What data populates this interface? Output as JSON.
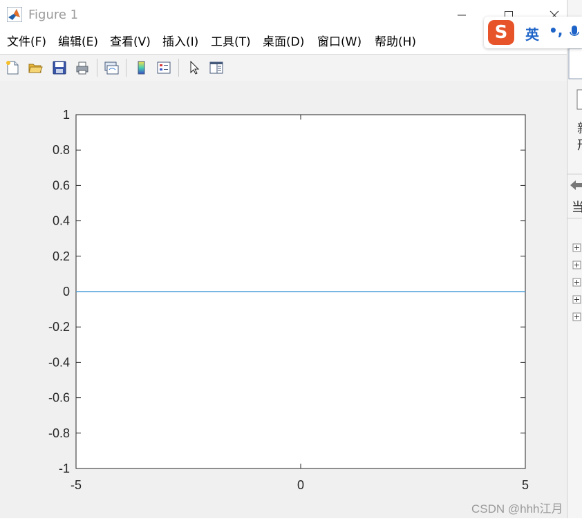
{
  "window": {
    "title": "Figure 1"
  },
  "menu": [
    {
      "label": "文件(F)"
    },
    {
      "label": "编辑(E)"
    },
    {
      "label": "查看(V)"
    },
    {
      "label": "插入(I)"
    },
    {
      "label": "工具(T)"
    },
    {
      "label": "桌面(D)"
    },
    {
      "label": "窗口(W)"
    },
    {
      "label": "帮助(H)"
    }
  ],
  "toolbar": {
    "icons": [
      "new-figure-icon",
      "open-file-icon",
      "save-icon",
      "print-icon",
      "link-plot-icon",
      "colorbar-icon",
      "legend-icon",
      "edit-plot-icon",
      "property-inspector-icon"
    ]
  },
  "chart_data": {
    "type": "line",
    "title": "",
    "xlabel": "",
    "ylabel": "",
    "xlim": [
      -5,
      5
    ],
    "ylim": [
      -1,
      1
    ],
    "x_ticks": [
      "-5",
      "0",
      "5"
    ],
    "y_ticks": [
      "1",
      "0.8",
      "0.6",
      "0.4",
      "0.2",
      "0",
      "-0.2",
      "-0.4",
      "-0.6",
      "-0.8",
      "-1"
    ],
    "grid": false,
    "series": [
      {
        "x": [
          -5,
          5
        ],
        "y": [
          0,
          0
        ],
        "color": "#4a9fd8"
      }
    ]
  },
  "side_panel": {
    "chars": [
      "新",
      "形",
      "当"
    ]
  },
  "ime": {
    "logo": "S",
    "mode": "英",
    "punct": "•,"
  },
  "watermark": "CSDN @hhh江月"
}
